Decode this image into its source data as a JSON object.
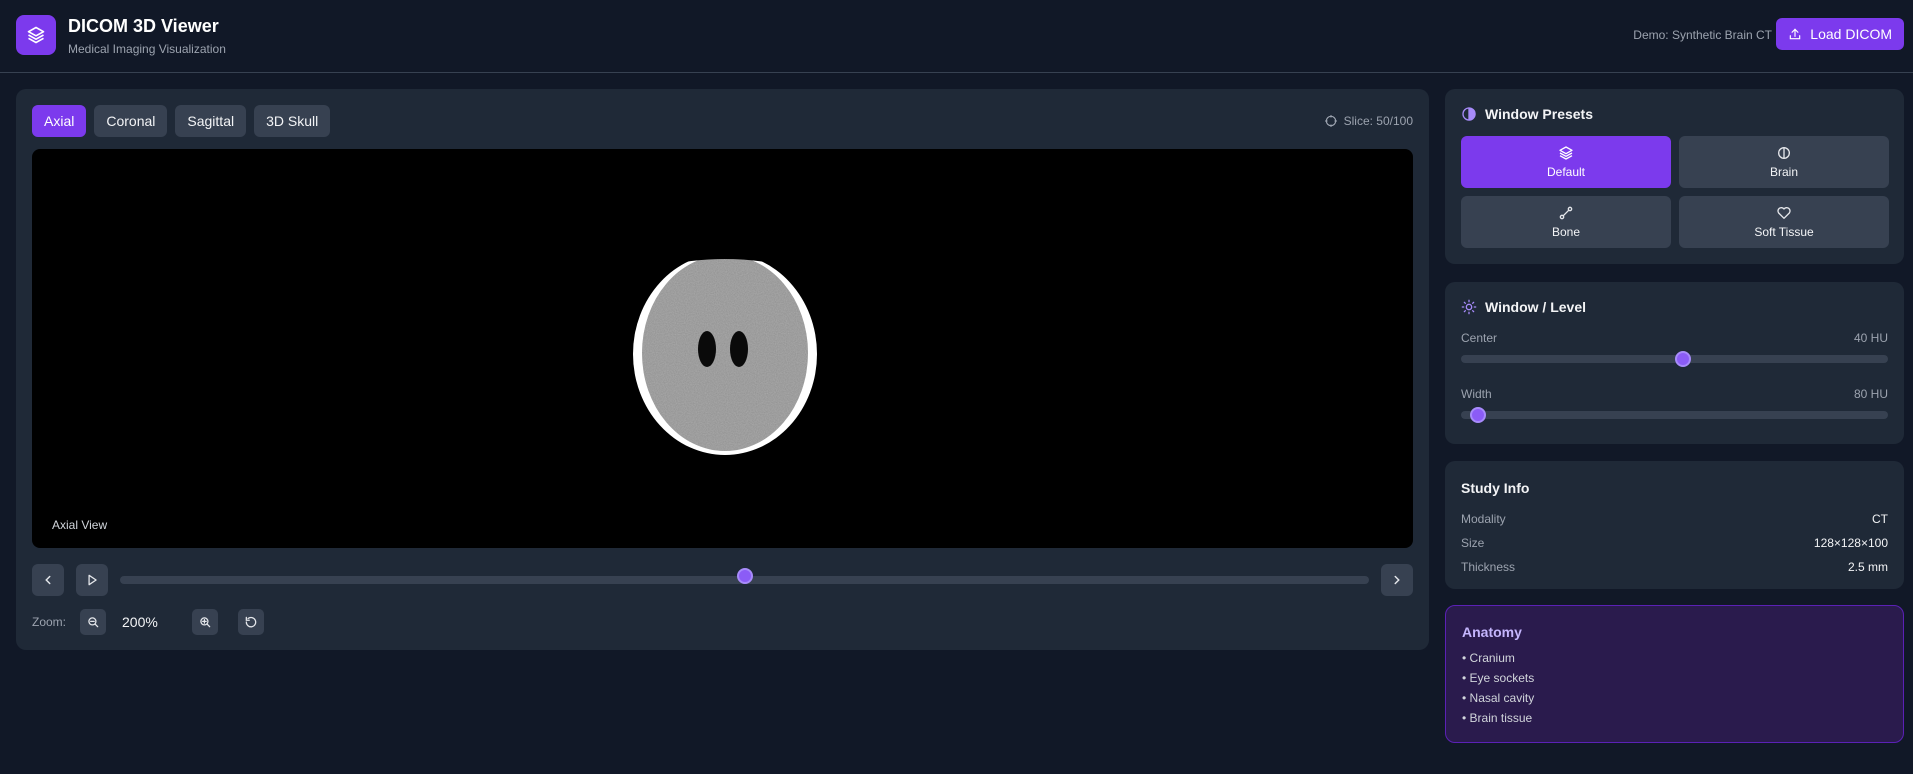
{
  "header": {
    "title": "DICOM 3D Viewer",
    "subtitle": "Medical Imaging Visualization",
    "demo_label": "Demo: Synthetic Brain CT",
    "load_button": "Load DICOM"
  },
  "viewer": {
    "tabs": [
      {
        "label": "Axial",
        "active": true
      },
      {
        "label": "Coronal",
        "active": false
      },
      {
        "label": "Sagittal",
        "active": false
      },
      {
        "label": "3D Skull",
        "active": false
      }
    ],
    "slice_label": "Slice: 50/100",
    "slice_current": 50,
    "slice_total": 100,
    "view_label": "Axial View",
    "zoom_label": "Zoom:",
    "zoom_value": "200%"
  },
  "window_presets": {
    "title": "Window Presets",
    "items": [
      {
        "label": "Default",
        "icon": "layers-icon",
        "active": true
      },
      {
        "label": "Brain",
        "icon": "brain-icon",
        "active": false
      },
      {
        "label": "Bone",
        "icon": "bone-icon",
        "active": false
      },
      {
        "label": "Soft Tissue",
        "icon": "heart-icon",
        "active": false
      }
    ]
  },
  "window_level": {
    "title": "Window / Level",
    "center_label": "Center",
    "center_value": "40 HU",
    "center_fraction": 0.52,
    "width_label": "Width",
    "width_value": "80 HU",
    "width_fraction": 0.04
  },
  "study_info": {
    "title": "Study Info",
    "rows": [
      {
        "key": "Modality",
        "value": "CT"
      },
      {
        "key": "Size",
        "value": "128×128×100"
      },
      {
        "key": "Thickness",
        "value": "2.5 mm"
      }
    ]
  },
  "anatomy": {
    "title": "Anatomy",
    "items": [
      "• Cranium",
      "• Eye sockets",
      "• Nasal cavity",
      "• Brain tissue"
    ]
  },
  "colors": {
    "accent": "#7c3aed",
    "background": "#111827",
    "panel": "#1f2937"
  }
}
